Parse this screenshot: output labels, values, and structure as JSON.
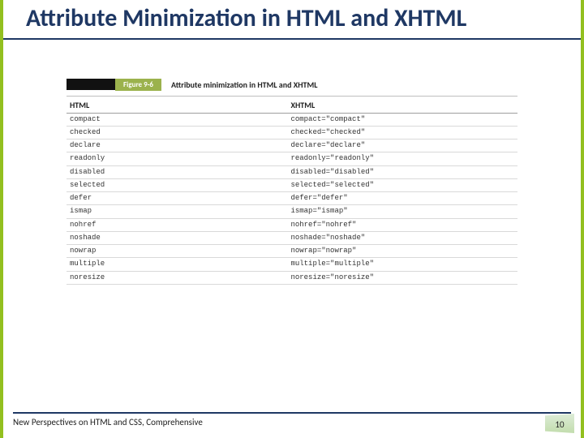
{
  "title": "Attribute Minimization in HTML and XHTML",
  "figure": {
    "tag": "Figure 9-6",
    "caption": "Attribute minimization in HTML and XHTML",
    "headers": {
      "html": "HTML",
      "xhtml": "XHTML"
    },
    "rows": [
      {
        "html": "compact",
        "xhtml": "compact=\"compact\""
      },
      {
        "html": "checked",
        "xhtml": "checked=\"checked\""
      },
      {
        "html": "declare",
        "xhtml": "declare=\"declare\""
      },
      {
        "html": "readonly",
        "xhtml": "readonly=\"readonly\""
      },
      {
        "html": "disabled",
        "xhtml": "disabled=\"disabled\""
      },
      {
        "html": "selected",
        "xhtml": "selected=\"selected\""
      },
      {
        "html": "defer",
        "xhtml": "defer=\"defer\""
      },
      {
        "html": "ismap",
        "xhtml": "ismap=\"ismap\""
      },
      {
        "html": "nohref",
        "xhtml": "nohref=\"nohref\""
      },
      {
        "html": "noshade",
        "xhtml": "noshade=\"noshade\""
      },
      {
        "html": "nowrap",
        "xhtml": "nowrap=\"nowrap\""
      },
      {
        "html": "multiple",
        "xhtml": "multiple=\"multiple\""
      },
      {
        "html": "noresize",
        "xhtml": "noresize=\"noresize\""
      }
    ]
  },
  "footer": {
    "text": "New Perspectives on HTML and CSS, Comprehensive",
    "page": "10"
  }
}
